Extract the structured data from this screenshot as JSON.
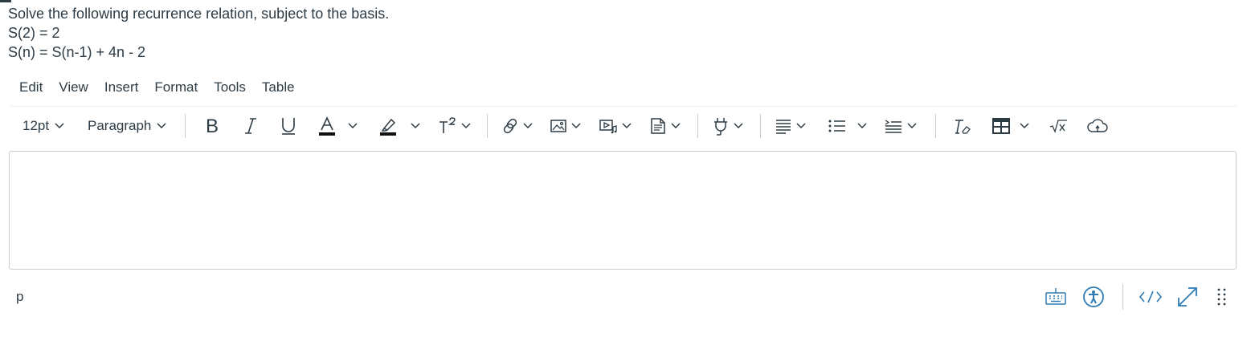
{
  "question": {
    "line1": "Solve the following recurrence relation, subject to the basis.",
    "line2": "S(2) = 2",
    "line3": "S(n) = S(n-1) + 4n - 2"
  },
  "menubar": {
    "items": [
      {
        "label": "Edit"
      },
      {
        "label": "View"
      },
      {
        "label": "Insert"
      },
      {
        "label": "Format"
      },
      {
        "label": "Tools"
      },
      {
        "label": "Table"
      }
    ]
  },
  "toolbar": {
    "font_size": "12pt",
    "block_format": "Paragraph",
    "icons": [
      "bold-icon",
      "italic-icon",
      "underline-icon",
      "text-color-icon",
      "highlight-icon",
      "superscript-icon",
      "link-icon",
      "image-icon",
      "media-icon",
      "document-icon",
      "plugin-icon",
      "align-icon",
      "bullet-list-icon",
      "indent-icon",
      "clear-formatting-icon",
      "table-icon",
      "math-equation-icon",
      "cloud-upload-icon"
    ],
    "accent_color": "#2d3b45"
  },
  "editor": {
    "content": ""
  },
  "statusbar": {
    "path": "p",
    "icons": [
      "keyboard-shortcuts-icon",
      "accessibility-checker-icon",
      "html-editor-icon",
      "fullscreen-icon",
      "resize-handle-icon"
    ],
    "link_color": "#2d7bb4"
  }
}
